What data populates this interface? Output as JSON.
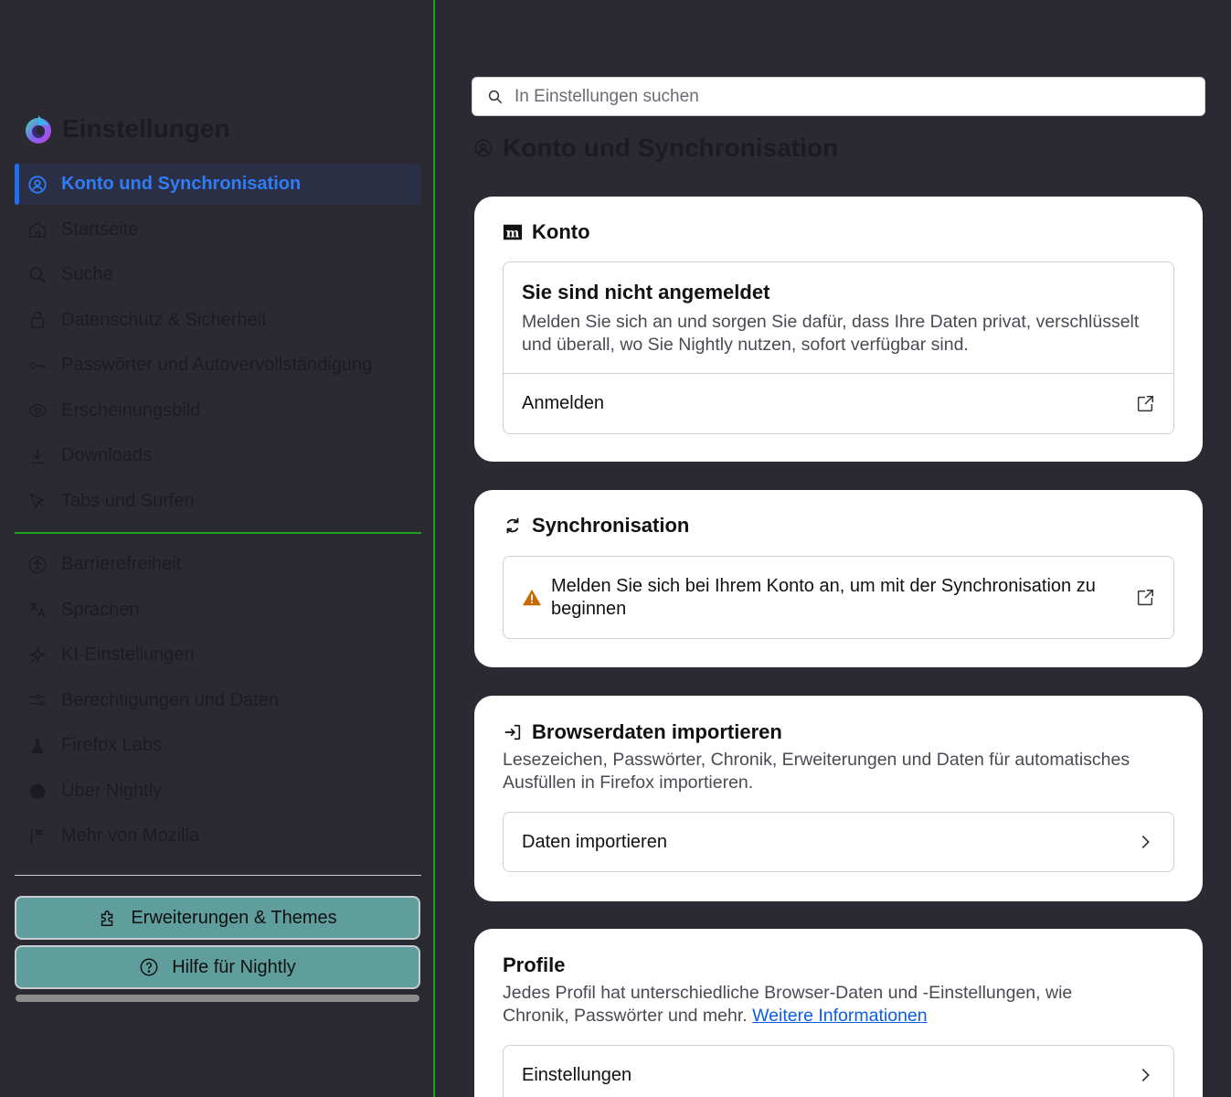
{
  "sidebar": {
    "title": "Einstellungen",
    "items": [
      {
        "label": "Konto und Synchronisation",
        "icon": "account-icon",
        "active": true
      },
      {
        "label": "Startseite",
        "icon": "home-icon"
      },
      {
        "label": "Suche",
        "icon": "search-icon"
      },
      {
        "label": "Datenschutz & Sicherheit",
        "icon": "lock-icon"
      },
      {
        "label": "Passwörter und Autovervollständigung",
        "icon": "key-icon"
      },
      {
        "label": "Erscheinungsbild",
        "icon": "eye-icon"
      },
      {
        "label": "Downloads",
        "icon": "download-icon"
      },
      {
        "label": "Tabs und Surfen",
        "icon": "cursor-icon"
      }
    ],
    "items2": [
      {
        "label": "Barrierefreiheit",
        "icon": "accessibility-icon"
      },
      {
        "label": "Sprachen",
        "icon": "translate-icon"
      },
      {
        "label": "KI-Einstellungen",
        "icon": "sparkle-icon"
      },
      {
        "label": "Berechtigungen und Daten",
        "icon": "sliders-icon"
      },
      {
        "label": "Firefox Labs",
        "icon": "flask-icon"
      },
      {
        "label": "Über Nightly",
        "icon": "nightly-logo-icon"
      },
      {
        "label": "Mehr von Mozilla",
        "icon": "mozilla-flag-icon"
      }
    ],
    "extensions_button": "Erweiterungen & Themes",
    "help_button": "Hilfe für Nightly"
  },
  "search": {
    "placeholder": "In Einstellungen suchen"
  },
  "page_title": "Konto und Synchronisation",
  "account": {
    "heading": "Konto",
    "status_title": "Sie sind nicht angemeldet",
    "status_desc": "Melden Sie sich an und sorgen Sie dafür, dass Ihre Daten privat, verschlüsselt und überall, wo Sie Nightly nutzen, sofort verfügbar sind.",
    "signin_label": "Anmelden"
  },
  "sync": {
    "heading": "Synchronisation",
    "warning": "Melden Sie sich bei Ihrem Konto an, um mit der Synchronisation zu beginnen"
  },
  "import": {
    "heading": "Browserdaten importieren",
    "desc": "Lesezeichen, Passwörter, Chronik, Erweiterungen und Daten für automatisches Ausfüllen in Firefox importieren.",
    "button": "Daten importieren"
  },
  "profiles": {
    "heading": "Profile",
    "desc": "Jedes Profil hat unterschiedliche Browser-Daten und -Einstellungen, wie Chronik, Passwörter und mehr.",
    "link": "Weitere Informationen",
    "button": "Einstellungen"
  },
  "colors": {
    "accent": "#1f6ef0",
    "warning": "#c86a00",
    "sidebar_button": "#5f9e9c",
    "divider": "#1ba21b"
  }
}
